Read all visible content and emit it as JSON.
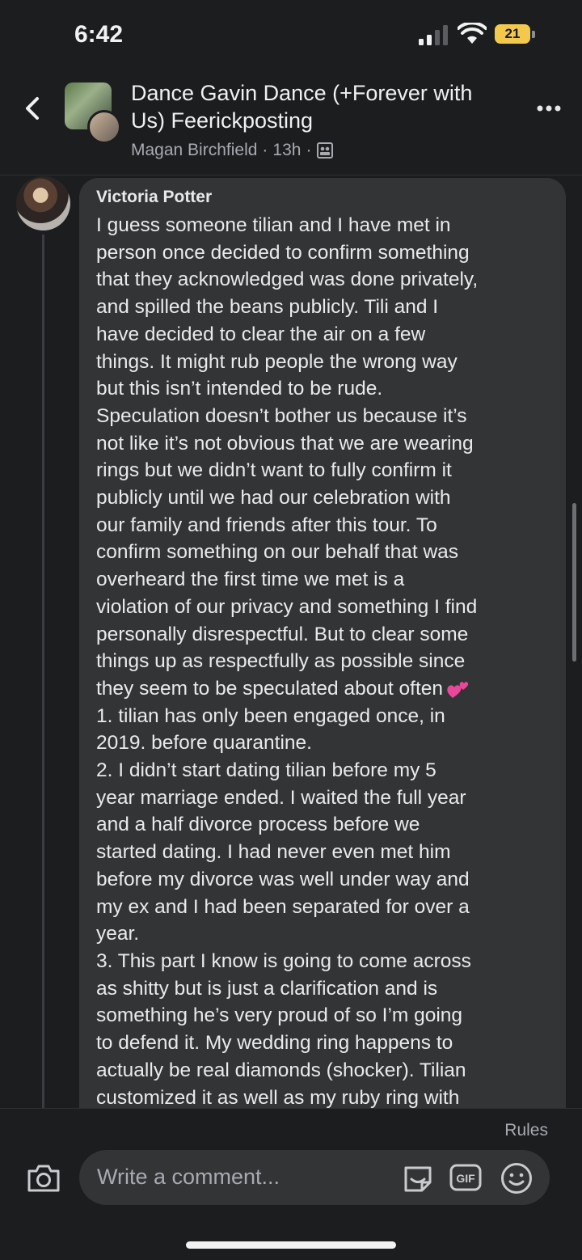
{
  "status_bar": {
    "time": "6:42",
    "battery": "21"
  },
  "header": {
    "title": "Dance Gavin Dance (+Forever with Us) Feerickposting",
    "title_line1": "Dance Gavin Dance (+Forever with",
    "title_line2": "Us) Feerickposting",
    "poster": "Magan Birchfield",
    "sep1": "·",
    "time_ago": "13h",
    "sep2": "·"
  },
  "comment": {
    "author": "Victoria Potter",
    "lines": [
      "I guess someone tilian and I have met in",
      "person once decided to confirm something",
      "that they acknowledged was done privately,",
      "and spilled the beans publicly. Tili and I",
      "have decided to clear the air on a few",
      "things. It might rub people the wrong way",
      "but this isn’t intended to be rude.",
      "Speculation doesn’t bother us because it’s",
      "not like it’s not obvious that we are wearing",
      "rings but we didn’t want to fully confirm it",
      "publicly until we had our celebration with",
      "our family and friends after this tour. To",
      "confirm something on our behalf that was",
      "overheard the first time we met is a",
      "violation of our privacy and something I find",
      "personally disrespectful. But to clear some",
      "things up as respectfully as possible since",
      "they seem to be speculated about often",
      "1. tilian has only been engaged once, in",
      "2019. before quarantine.",
      "2. I didn’t start dating tilian before my 5",
      "year marriage ended. I waited the full year",
      "and a half divorce process before we",
      "started dating. I had never even met him",
      "before my divorce was well under way and",
      "my ex and I had been separated for over a",
      "year.",
      "3. This part I know is going to come across",
      "as shitty but is just a clarification and is",
      "something he’s very proud of so I’m going",
      "to defend it. My wedding ring happens to",
      "actually be real diamonds (shocker). Tilian",
      "customized it as well as my ruby ring with"
    ]
  },
  "composer": {
    "rules_label": "Rules",
    "placeholder": "Write a comment...",
    "gif_label": "GIF"
  },
  "colors": {
    "background": "#1c1d1f",
    "bubble": "#333436",
    "text": "#e9eaec",
    "muted": "#a7aab0",
    "battery": "#f2c94c",
    "heart_emoji": "#e8479a"
  },
  "icons": [
    "back-arrow-icon",
    "more-icon",
    "group-privacy-icon",
    "two-hearts-emoji",
    "camera-icon",
    "sticker-icon",
    "gif-icon",
    "emoji-icon"
  ]
}
